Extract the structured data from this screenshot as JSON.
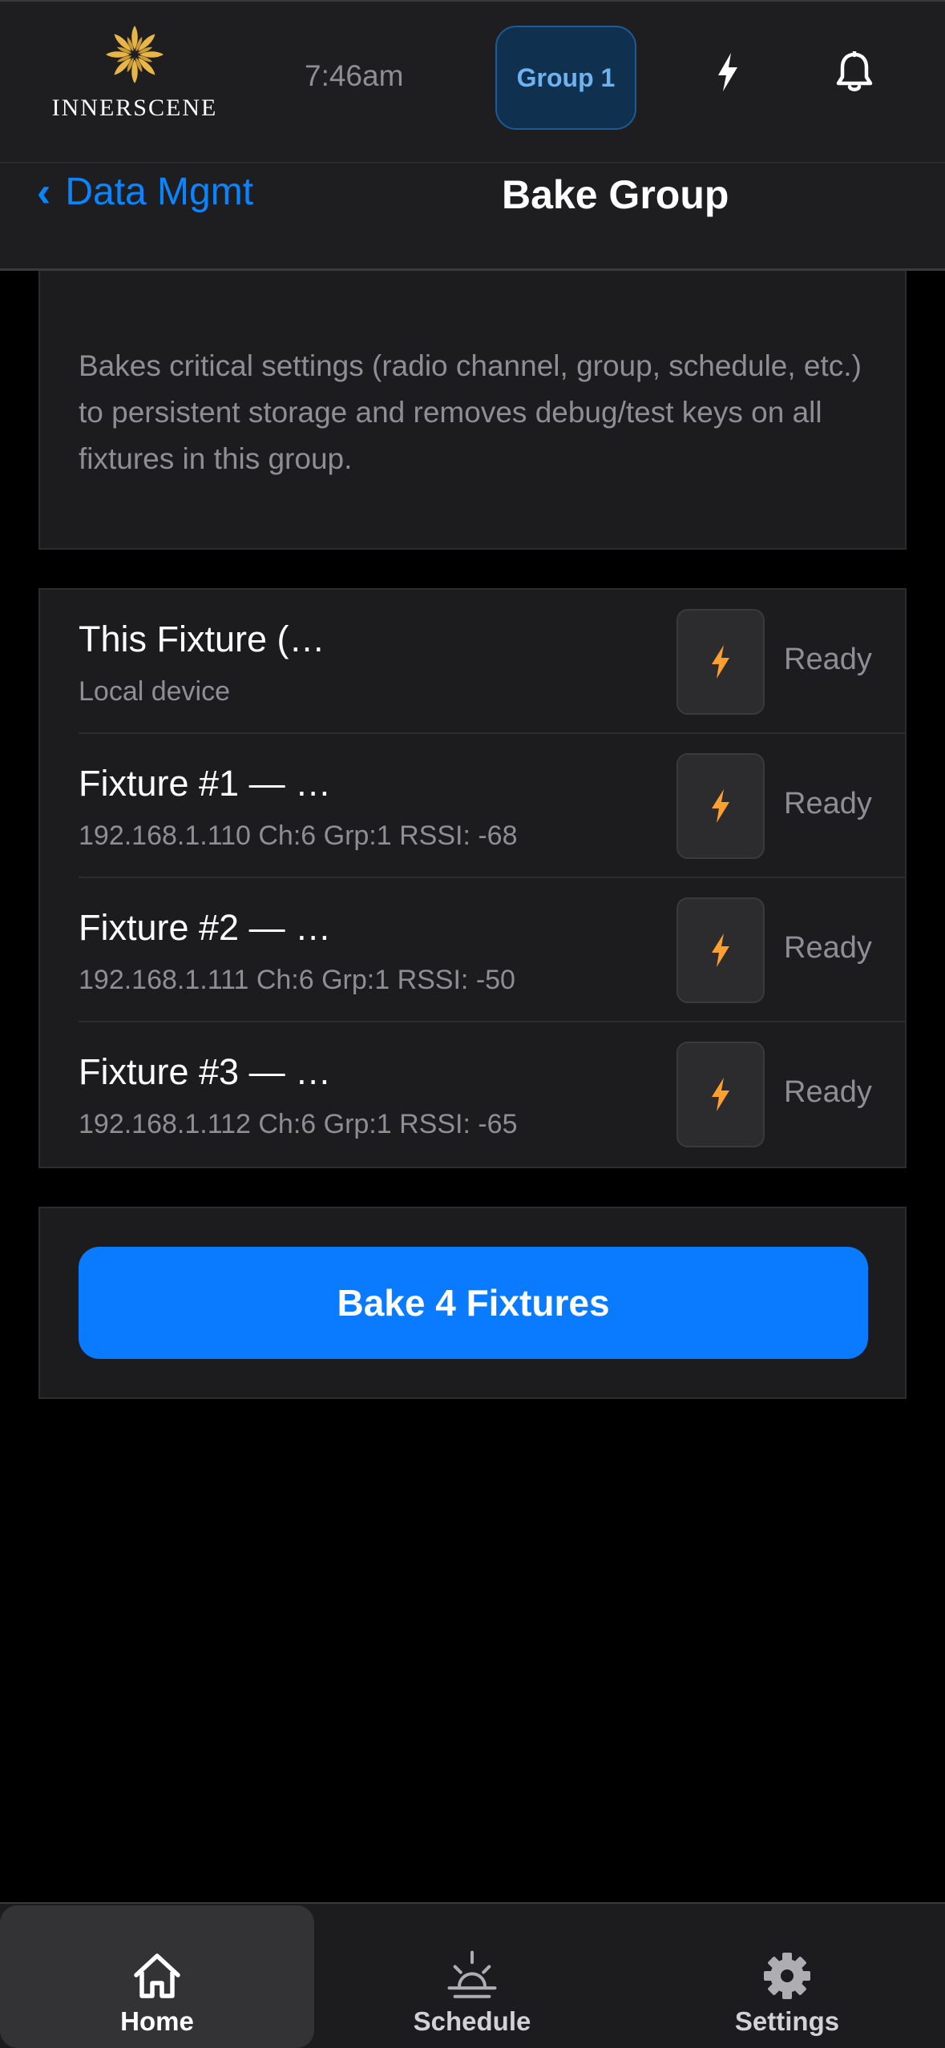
{
  "app": {
    "logo_text": "INNERSCENE",
    "time": "7:46am",
    "group_label": "Group 1"
  },
  "nav": {
    "back_label": "Data Mgmt",
    "back_chevron": "‹",
    "title": "Bake Group"
  },
  "description": "Bakes critical settings (radio channel, group, schedule, etc.) to persistent storage and removes debug/test keys on all fixtures in this group.",
  "fixtures": [
    {
      "name": "This Fixture (…",
      "detail": "Local device",
      "status": "Ready"
    },
    {
      "name": "Fixture #1 — …",
      "detail": "192.168.1.110 Ch:6 Grp:1 RSSI: -68",
      "status": "Ready"
    },
    {
      "name": "Fixture #2 — …",
      "detail": "192.168.1.111 Ch:6 Grp:1 RSSI: -50",
      "status": "Ready"
    },
    {
      "name": "Fixture #3 — …",
      "detail": "192.168.1.112 Ch:6 Grp:1 RSSI: -65",
      "status": "Ready"
    }
  ],
  "action": {
    "bake_all_label": "Bake 4 Fixtures"
  },
  "tabs": [
    {
      "label": "Home",
      "icon": "home-icon",
      "active": true
    },
    {
      "label": "Schedule",
      "icon": "sunrise-icon",
      "active": false
    },
    {
      "label": "Settings",
      "icon": "gear-icon",
      "active": false
    }
  ],
  "colors": {
    "accent": "#0a84ff",
    "bolt": "#ff9f2e",
    "logo_gold": "#e8b547",
    "background": "#000000",
    "card": "#1c1c1e"
  }
}
